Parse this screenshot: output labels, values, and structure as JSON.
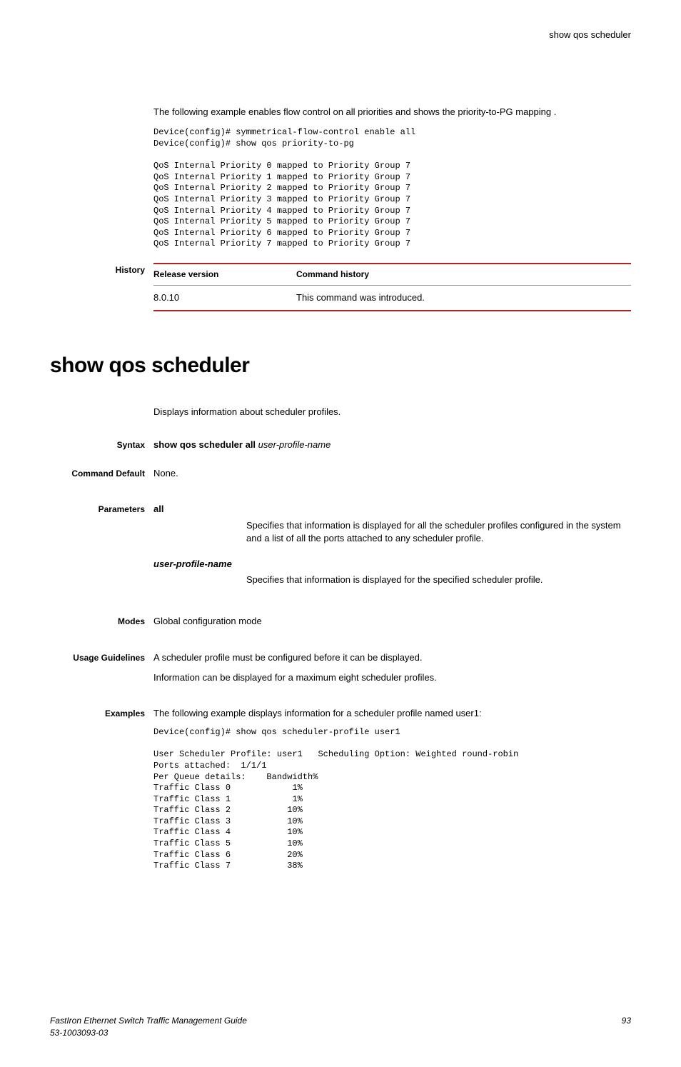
{
  "header": {
    "topic": "show qos scheduler"
  },
  "prev_section": {
    "intro": "The following example enables flow control on all priorities and shows the priority-to-PG mapping .",
    "code": "Device(config)# symmetrical-flow-control enable all\nDevice(config)# show qos priority-to-pg\n\nQoS Internal Priority 0 mapped to Priority Group 7\nQoS Internal Priority 1 mapped to Priority Group 7\nQoS Internal Priority 2 mapped to Priority Group 7\nQoS Internal Priority 3 mapped to Priority Group 7\nQoS Internal Priority 4 mapped to Priority Group 7\nQoS Internal Priority 5 mapped to Priority Group 7\nQoS Internal Priority 6 mapped to Priority Group 7\nQoS Internal Priority 7 mapped to Priority Group 7"
  },
  "history": {
    "label": "History",
    "headers": {
      "release": "Release version",
      "command": "Command history"
    },
    "row": {
      "release": "8.0.10",
      "command": "This command was introduced."
    }
  },
  "title": "show qos scheduler",
  "description": "Displays information about scheduler profiles.",
  "syntax": {
    "label": "Syntax",
    "cmd_bold": "show qos scheduler all",
    "cmd_italic": "user-profile-name"
  },
  "command_default": {
    "label": "Command Default",
    "value": "None."
  },
  "parameters": {
    "label": "Parameters",
    "items": [
      {
        "name": "all",
        "italic": false,
        "desc": "Specifies that information is displayed for all the scheduler profiles configured in the system and a list of all the ports attached to any scheduler profile."
      },
      {
        "name": "user-profile-name",
        "italic": true,
        "desc": "Specifies that information is displayed for the specified scheduler profile."
      }
    ]
  },
  "modes": {
    "label": "Modes",
    "value": "Global configuration mode"
  },
  "usage": {
    "label": "Usage Guidelines",
    "line1": "A scheduler profile must be configured before it can be displayed.",
    "line2": "Information can be displayed for a maximum eight scheduler profiles."
  },
  "examples": {
    "label": "Examples",
    "intro": "The following example displays information for a scheduler profile named user1:",
    "code": "Device(config)# show qos scheduler-profile user1\n\nUser Scheduler Profile: user1   Scheduling Option: Weighted round-robin\nPorts attached:  1/1/1\nPer Queue details:    Bandwidth%\nTraffic Class 0            1%\nTraffic Class 1            1%\nTraffic Class 2           10%\nTraffic Class 3           10%\nTraffic Class 4           10%\nTraffic Class 5           10%\nTraffic Class 6           20%\nTraffic Class 7           38%"
  },
  "footer": {
    "line1": "FastIron Ethernet Switch Traffic Management Guide",
    "line2": "53-1003093-03",
    "page": "93"
  }
}
